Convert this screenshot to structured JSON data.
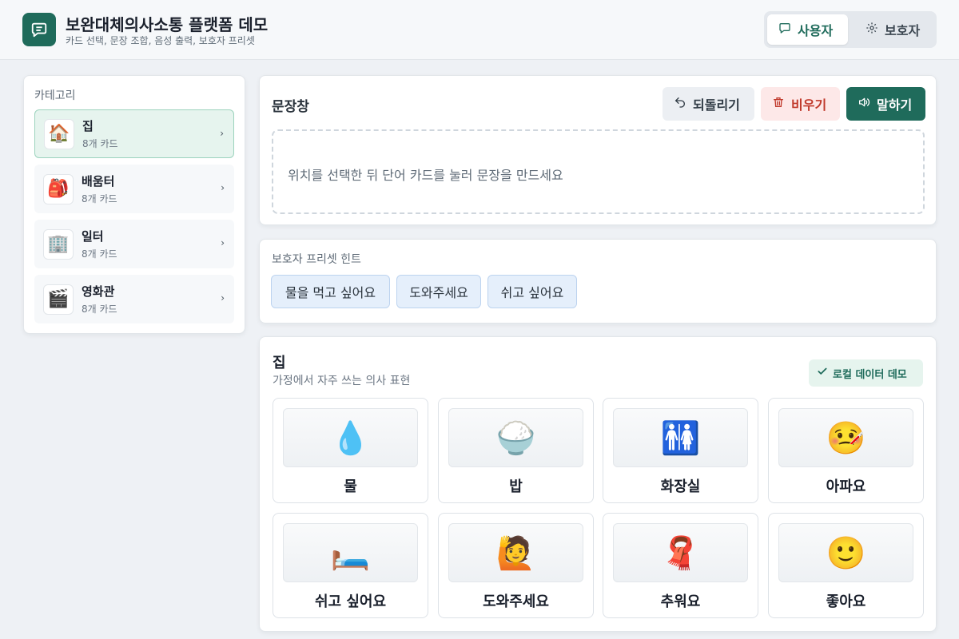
{
  "header": {
    "title": "보완대체의사소통 플랫폼 데모",
    "subtitle": "카드 선택, 문장 조합, 음성 출력, 보호자 프리셋",
    "logo_icon": "chat-bubble-icon",
    "modes": [
      {
        "label": "사용자",
        "icon": "chat-bubble-icon",
        "active": true
      },
      {
        "label": "보호자",
        "icon": "gear-icon",
        "active": false
      }
    ]
  },
  "sidebar": {
    "title": "카테고리",
    "items": [
      {
        "name": "집",
        "count": "8개 카드",
        "icon": "🏠",
        "active": true
      },
      {
        "name": "배움터",
        "count": "8개 카드",
        "icon": "🎒",
        "active": false
      },
      {
        "name": "일터",
        "count": "8개 카드",
        "icon": "🏢",
        "active": false
      },
      {
        "name": "영화관",
        "count": "8개 카드",
        "icon": "🎬",
        "active": false
      }
    ]
  },
  "sentence": {
    "title": "문장창",
    "undo_label": "되돌리기",
    "clear_label": "비우기",
    "speak_label": "말하기",
    "placeholder": "위치를 선택한 뒤 단어 카드를 눌러 문장을 만드세요"
  },
  "presets": {
    "title": "보호자 프리셋 힌트",
    "items": [
      "물을 먹고 싶어요",
      "도와주세요",
      "쉬고 싶어요"
    ]
  },
  "board": {
    "title": "집",
    "subtitle": "가정에서 자주 쓰는 의사 표현",
    "badge": "로컬 데이터 데모",
    "cards": [
      {
        "label": "물",
        "icon": "💧"
      },
      {
        "label": "밥",
        "icon": "🍚"
      },
      {
        "label": "화장실",
        "icon": "🚻"
      },
      {
        "label": "아파요",
        "icon": "🤒"
      },
      {
        "label": "쉬고 싶어요",
        "icon": "🛏️"
      },
      {
        "label": "도와주세요",
        "icon": "🙋"
      },
      {
        "label": "추워요",
        "icon": "🧣"
      },
      {
        "label": "좋아요",
        "icon": "🙂"
      }
    ]
  },
  "colors": {
    "accent": "#1f6b5b",
    "danger": "#c0392b",
    "chip_bg": "#e5effb"
  }
}
